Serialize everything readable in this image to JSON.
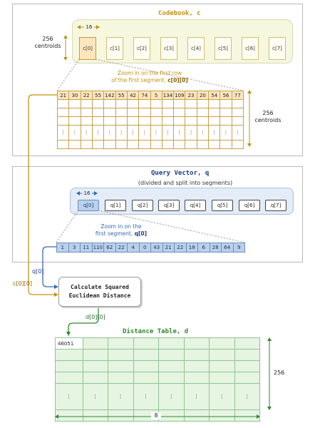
{
  "codebook": {
    "title": "Codebook, c",
    "width_label": "16",
    "rows_label_line1": "256",
    "rows_label_line2": "centroids",
    "boxes": [
      "c[0]",
      "c[1]",
      "c[2]",
      "c[3]",
      "c[4]",
      "c[5]",
      "c[6]",
      "c[7]"
    ],
    "zoom_line1": "Zoom in on the first row",
    "zoom_line2_prefix": "of the first segment, ",
    "zoom_line2_bold": "c[0][0]",
    "first_row_values": [
      "21",
      "30",
      "22",
      "55",
      "142",
      "55",
      "42",
      "74",
      "5",
      "134",
      "109",
      "23",
      "20",
      "54",
      "56",
      "77"
    ],
    "ellipsis": "⋮",
    "right_label_line1": "256",
    "right_label_line2": "centroids"
  },
  "query": {
    "title": "Query Vector, q",
    "subtitle": "(divided and split into segments)",
    "width_label": "16",
    "boxes": [
      "q[0]",
      "q[1]",
      "q[2]",
      "q[3]",
      "q[4]",
      "q[5]",
      "q[6]",
      "q[7]"
    ],
    "zoom_line1": "Zoom in on the",
    "zoom_line2_prefix": "first segment, ",
    "zoom_line2_bold": "q[0]",
    "segment_values": [
      "1",
      "3",
      "11",
      "110",
      "62",
      "22",
      "4",
      "0",
      "43",
      "21",
      "22",
      "18",
      "6",
      "28",
      "64",
      "9"
    ]
  },
  "calc": {
    "line1": "Calculate Squared",
    "line2": "Euclidean Distance"
  },
  "flows": {
    "q_label": "q[0]",
    "c_label": "c[0][0]",
    "d_label": "d[0][0]"
  },
  "distance": {
    "title": "Distance Table, d",
    "first_value": "46051",
    "ellipsis": "⋮",
    "rows_label": "256",
    "cols_label": "8"
  },
  "colors": {
    "gold": "#c49212",
    "blue": "#3869b0",
    "green": "#2e8a2e"
  }
}
